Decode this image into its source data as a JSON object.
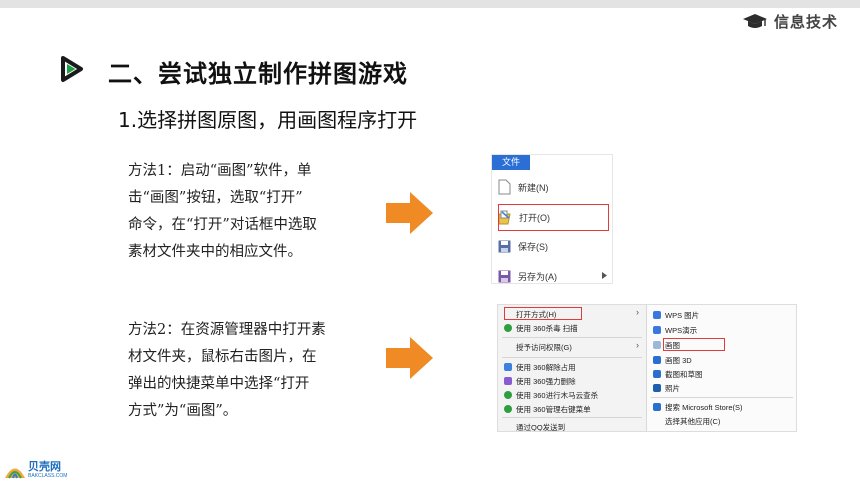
{
  "brand": {
    "label": "信息技术"
  },
  "heading": {
    "title": "二、尝试独立制作拼图游戏"
  },
  "subheading": {
    "text": "1.选择拼图原图，用画图程序打开"
  },
  "method1": {
    "lines": [
      "方法1：启动“画图”软件，单",
      "击“画图”按钮，选取“打开”",
      "命令，在“打开”对话框中选取",
      "素材文件夹中的相应文件。"
    ]
  },
  "method2": {
    "lines": [
      "方法2：在资源管理器中打开素",
      "材文件夹，鼠标右击图片，在",
      "弹出的快捷菜单中选择“打开",
      "方式”为“画图”。"
    ]
  },
  "file_menu": {
    "tab": "文件",
    "items": [
      "新建(N)",
      "打开(O)",
      "保存(S)",
      "另存为(A)"
    ]
  },
  "context_menu": {
    "left_items": [
      "打开方式(H)",
      "使用 360杀毒 扫描",
      "授予访问权限(G)",
      "使用 360解除占用",
      "使用 360强力删除",
      "使用 360进行木马云查杀",
      "使用 360管理右键菜单",
      "通过QQ发送到"
    ],
    "right_items": [
      "WPS 图片",
      "WPS演示",
      "画图",
      "画图 3D",
      "截图和草图",
      "照片",
      "搜索 Microsoft Store(S)",
      "选择其他应用(C)"
    ]
  },
  "footer_logo": {
    "title": "贝壳网",
    "sub": "BAKCLASS.COM"
  },
  "colors": {
    "accent_green": "#1fa046",
    "arrow_orange": "#f08a24",
    "highlight_red": "#e23b3b",
    "menu_blue": "#2b6fd6"
  }
}
